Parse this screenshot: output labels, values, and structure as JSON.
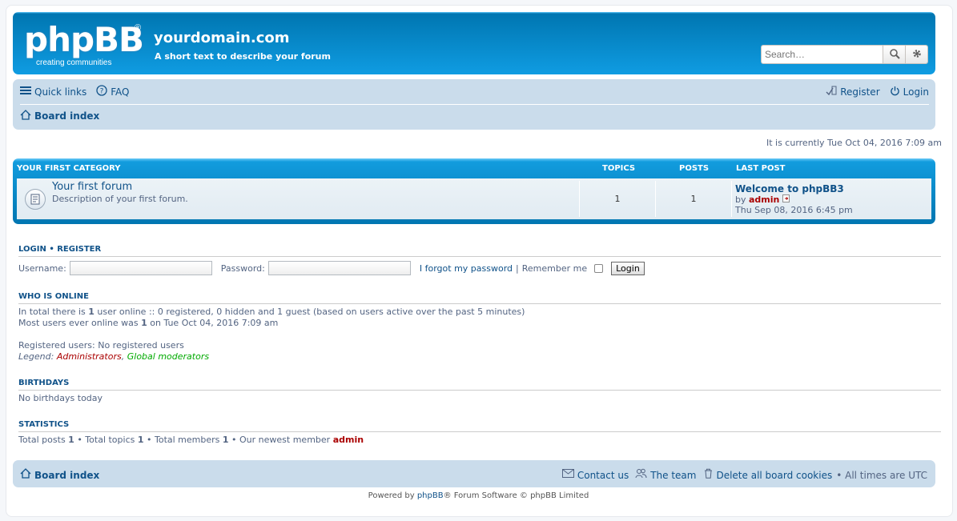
{
  "header": {
    "logo_text": "phpBB",
    "logo_reg": "®",
    "logo_tagline": "creating   communities",
    "site_name": "yourdomain.com",
    "site_description": "A short text to describe your forum",
    "search_placeholder": "Search…"
  },
  "navbar": {
    "quick_links": "Quick links",
    "faq": "FAQ",
    "register": "Register",
    "login": "Login",
    "board_index": "Board index"
  },
  "current_time": "It is currently Tue Oct 04, 2016 7:09 am",
  "forum_table": {
    "category": "YOUR FIRST CATEGORY",
    "col_topics": "TOPICS",
    "col_posts": "POSTS",
    "col_last_post": "LAST POST",
    "forum": {
      "title": "Your first forum",
      "description": "Description of your first forum.",
      "topics": "1",
      "posts": "1",
      "last_post_title": "Welcome to phpBB3",
      "last_post_by": "by",
      "last_post_author": "admin",
      "last_post_time": "Thu Sep 08, 2016 6:45 pm"
    }
  },
  "login_section": {
    "title_login": "LOGIN",
    "title_sep": "•",
    "title_register": "REGISTER",
    "username_label": "Username:",
    "password_label": "Password:",
    "forgot": "I forgot my password",
    "pipe": "|",
    "remember": "Remember me",
    "button": "Login"
  },
  "who_is_online": {
    "title": "WHO IS ONLINE",
    "line1_a": "In total there is ",
    "line1_b": "1",
    "line1_c": " user online :: 0 registered, 0 hidden and 1 guest (based on users active over the past 5 minutes)",
    "line2_a": "Most users ever online was ",
    "line2_b": "1",
    "line2_c": " on Tue Oct 04, 2016 7:09 am",
    "registered": "Registered users: No registered users",
    "legend_label": "Legend:",
    "legend_admins": "Administrators",
    "legend_comma": ",",
    "legend_mods": "Global moderators"
  },
  "birthdays": {
    "title": "BIRTHDAYS",
    "text": "No birthdays today"
  },
  "statistics": {
    "title": "STATISTICS",
    "a": "Total posts ",
    "b": "1",
    "c": " • Total topics ",
    "d": "1",
    "e": " • Total members ",
    "f": "1",
    "g": " • Our newest member ",
    "h": "admin"
  },
  "footer": {
    "board_index": "Board index",
    "contact": "Contact us",
    "team": "The team",
    "delete_cookies": "Delete all board cookies",
    "timezone": "• All times are UTC",
    "powered_a": "Powered by ",
    "powered_b": "phpBB",
    "powered_c": "® Forum Software © phpBB Limited"
  },
  "colors": {
    "header_blue": "#12a3eb",
    "nav_bg": "#cadceb",
    "link": "#105289",
    "admin": "#aa0000",
    "moderator": "#00aa00"
  }
}
